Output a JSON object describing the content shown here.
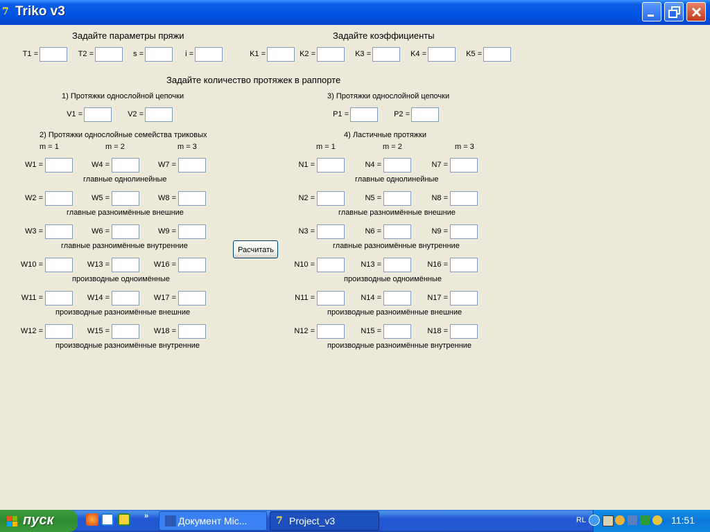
{
  "window": {
    "title": "Triko v3",
    "app_icon": "delphi-icon"
  },
  "sections": {
    "yarn_header": "Задайте параметры пряжи",
    "coef_header": "Задайте коэффициенты",
    "count_header": "Задайте количество протяжек в раппорте",
    "s1": "1) Протяжки однослойной цепочки",
    "s2": "2) Протяжки однослойные семейства триковых",
    "s3": "3) Протяжки однослойной цепочки",
    "s4": "4) Ластичные протяжки"
  },
  "m_labels": [
    "m = 1",
    "m = 2",
    "m = 3"
  ],
  "yarn_fields": [
    {
      "label": "T1 =",
      "value": ""
    },
    {
      "label": "T2 =",
      "value": ""
    },
    {
      "label": "s =",
      "value": ""
    },
    {
      "label": "i =",
      "value": ""
    }
  ],
  "coef_fields": [
    {
      "label": "K1 =",
      "value": ""
    },
    {
      "label": "K2 =",
      "value": ""
    },
    {
      "label": "K3 =",
      "value": ""
    },
    {
      "label": "K4 =",
      "value": ""
    },
    {
      "label": "K5 =",
      "value": ""
    }
  ],
  "v_fields": [
    {
      "label": "V1 =",
      "value": ""
    },
    {
      "label": "V2 =",
      "value": ""
    }
  ],
  "p_fields": [
    {
      "label": "P1 =",
      "value": ""
    },
    {
      "label": "P2 =",
      "value": ""
    }
  ],
  "w_rows": [
    {
      "labels": [
        "W1 =",
        "W4 =",
        "W7 ="
      ],
      "caption": "главные однолинейные"
    },
    {
      "labels": [
        "W2 =",
        "W5 =",
        "W8 ="
      ],
      "caption": "главные разноимённые внешние"
    },
    {
      "labels": [
        "W3 =",
        "W6 =",
        "W9 ="
      ],
      "caption": "главные разноимённые внутренние"
    },
    {
      "labels": [
        "W10 =",
        "W13 =",
        "W16 ="
      ],
      "caption": "производные одноимённые"
    },
    {
      "labels": [
        "W11 =",
        "W14 =",
        "W17 ="
      ],
      "caption": "производные разноимённые внешние"
    },
    {
      "labels": [
        "W12 =",
        "W15 =",
        "W18 ="
      ],
      "caption": "производные разноимённые внутренние"
    }
  ],
  "n_rows": [
    {
      "labels": [
        "N1 =",
        "N4 =",
        "N7 ="
      ],
      "caption": "главные однолинейные"
    },
    {
      "labels": [
        "N2 =",
        "N5 =",
        "N8 ="
      ],
      "caption": "главные разноимённые внешние"
    },
    {
      "labels": [
        "N3 =",
        "N6 =",
        "N9 ="
      ],
      "caption": "главные разноимённые внутренние"
    },
    {
      "labels": [
        "N10 =",
        "N13 =",
        "N16 ="
      ],
      "caption": "производные одноимённые"
    },
    {
      "labels": [
        "N11 =",
        "N14 =",
        "N17 ="
      ],
      "caption": "производные разноимённые внешние"
    },
    {
      "labels": [
        "N12 =",
        "N15 =",
        "N18 ="
      ],
      "caption": "производные разноимённые внутренние"
    }
  ],
  "calc_button": "Расчитать",
  "taskbar": {
    "start_label": "пуск",
    "more": "»",
    "tasks": [
      {
        "label": "Документ Mic...",
        "icon": "word-icon",
        "state": "inactive"
      },
      {
        "label": "Project_v3",
        "icon": "delphi-icon",
        "state": "active"
      }
    ],
    "lang": "RL",
    "clock": "11:51"
  },
  "colors": {
    "titlebar": "#0054E3",
    "face": "#ECE9D8",
    "taskbar": "#245EDC",
    "start": "#3C9E3C"
  }
}
